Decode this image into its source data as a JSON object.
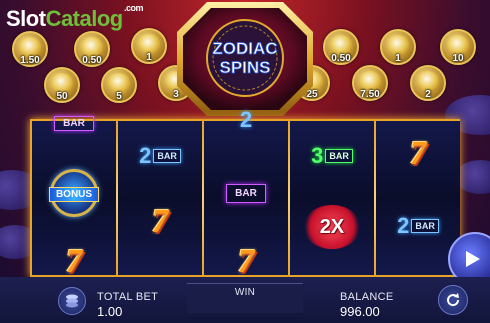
{
  "brand": {
    "part1": "Slot",
    "part2": "Catalog",
    "suffix": ".com"
  },
  "game": {
    "title_line1": "ZODIAC",
    "title_line2": "SPINS"
  },
  "coins_left": [
    {
      "value": "1.50",
      "icon": "zodiac-coin-icon"
    },
    {
      "value": "0.50",
      "icon": "zodiac-coin-icon"
    },
    {
      "value": "1",
      "icon": "zodiac-coin-icon"
    },
    {
      "value": "50",
      "icon": "zodiac-coin-icon"
    },
    {
      "value": "5",
      "icon": "zodiac-coin-icon"
    },
    {
      "value": "3",
      "icon": "zodiac-coin-icon"
    }
  ],
  "coins_right": [
    {
      "value": "0.50",
      "icon": "zodiac-coin-icon"
    },
    {
      "value": "1",
      "icon": "zodiac-coin-icon"
    },
    {
      "value": "10",
      "icon": "zodiac-coin-icon"
    },
    {
      "value": "25",
      "icon": "zodiac-coin-icon"
    },
    {
      "value": "7.50",
      "icon": "zodiac-coin-icon"
    },
    {
      "value": "2",
      "icon": "zodiac-coin-icon"
    }
  ],
  "reels": {
    "bar_label": "BAR",
    "bonus_label": "BONUS",
    "multiplier_label": "2X",
    "seven_label": "7",
    "two": "2",
    "three": "3"
  },
  "footer": {
    "total_bet_label": "TOTAL BET",
    "total_bet_value": "1.00",
    "win_label": "WIN",
    "win_value": "",
    "balance_label": "BALANCE",
    "balance_value": "996.00"
  },
  "colors": {
    "reel_frame": "#e8a426",
    "accent_green": "#6fbf3a",
    "bar_blue": "#7fc4ff"
  }
}
